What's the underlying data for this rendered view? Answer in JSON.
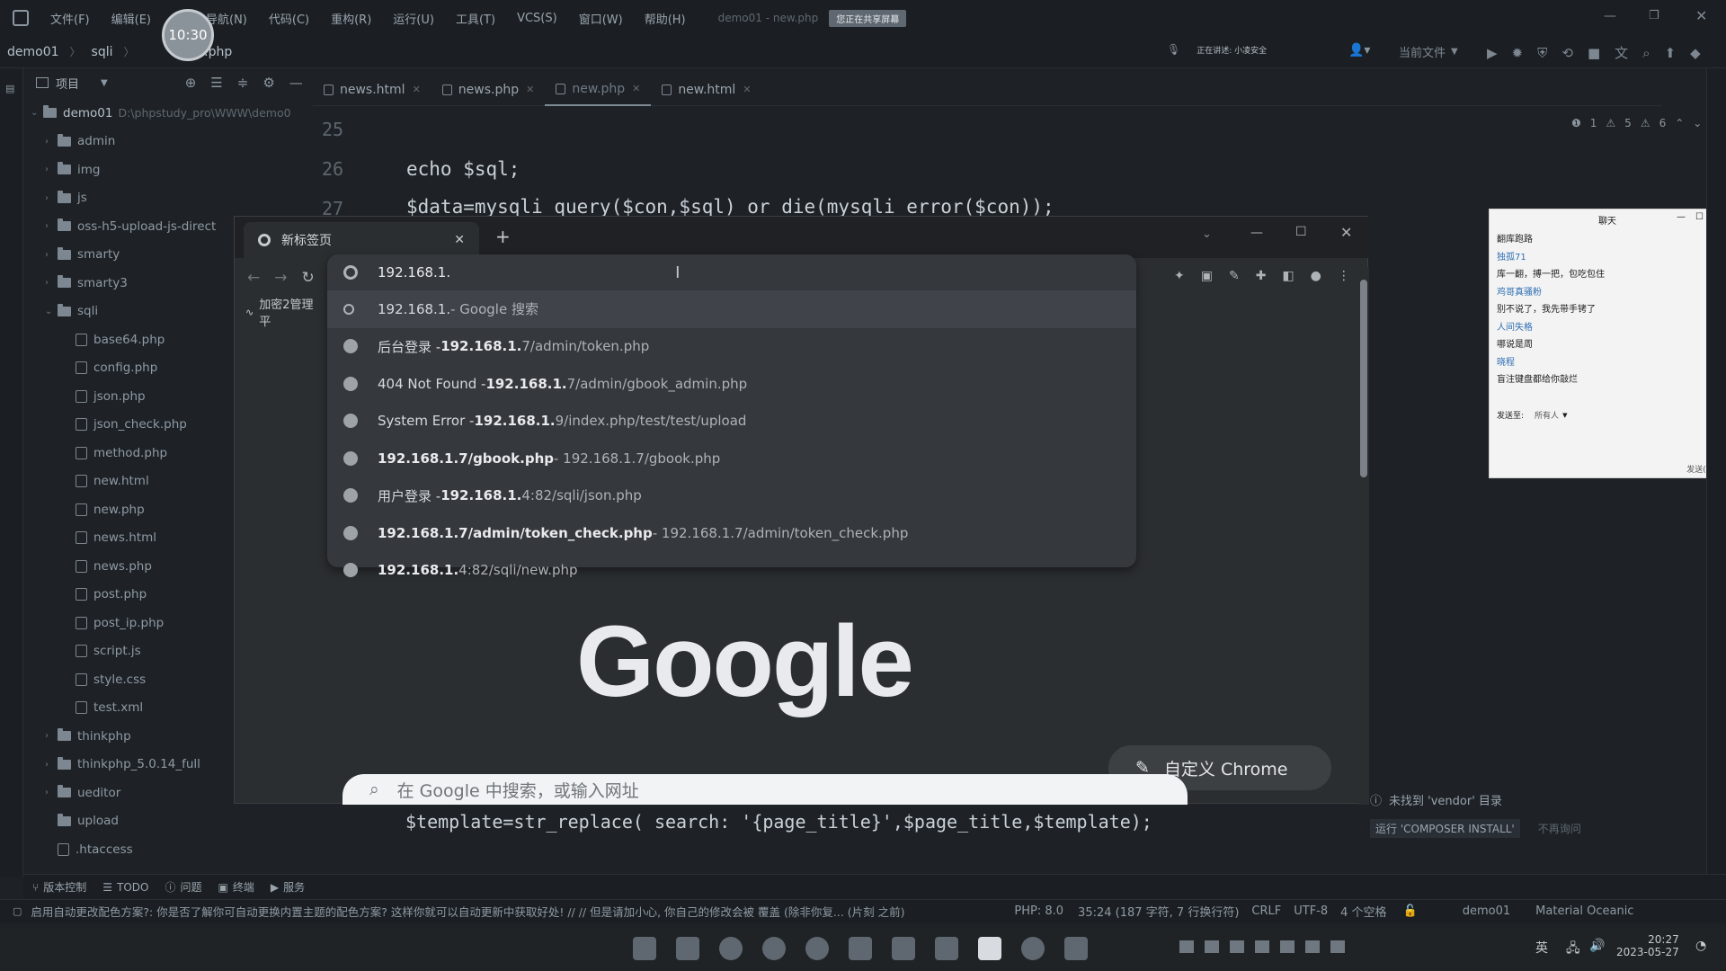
{
  "ide": {
    "menu": [
      "文件(F)",
      "编辑(E)",
      "视",
      "导航(N)",
      "代码(C)",
      "重构(R)",
      "运行(U)",
      "工具(T)",
      "VCS(S)",
      "窗口(W)",
      "帮助(H)"
    ],
    "title_hint": "demo01 - new.php",
    "sharing_badge": "您正在共享屏幕",
    "breadcrumb": [
      "demo01",
      "sqli",
      "new.php"
    ],
    "recording_time": "10:30",
    "speaking": "正在讲述: 小凌安全",
    "run_config": "当前文件",
    "project_label": "项目",
    "inspections": {
      "warn1": "1",
      "warn2": "5",
      "warn3": "6"
    }
  },
  "tree": [
    {
      "label": "demo01",
      "path": "D:\\phpstudy_pro\\WWW\\demo0",
      "depth": 0,
      "type": "folder",
      "open": true
    },
    {
      "label": "admin",
      "depth": 1,
      "type": "folder"
    },
    {
      "label": "img",
      "depth": 1,
      "type": "folder"
    },
    {
      "label": "js",
      "depth": 1,
      "type": "folder"
    },
    {
      "label": "oss-h5-upload-js-direct",
      "depth": 1,
      "type": "folder"
    },
    {
      "label": "smarty",
      "depth": 1,
      "type": "folder"
    },
    {
      "label": "smarty3",
      "depth": 1,
      "type": "folder"
    },
    {
      "label": "sqli",
      "depth": 1,
      "type": "folder",
      "open": true
    },
    {
      "label": "base64.php",
      "depth": 2,
      "type": "file"
    },
    {
      "label": "config.php",
      "depth": 2,
      "type": "file"
    },
    {
      "label": "json.php",
      "depth": 2,
      "type": "file"
    },
    {
      "label": "json_check.php",
      "depth": 2,
      "type": "file"
    },
    {
      "label": "method.php",
      "depth": 2,
      "type": "file"
    },
    {
      "label": "new.html",
      "depth": 2,
      "type": "file"
    },
    {
      "label": "new.php",
      "depth": 2,
      "type": "file"
    },
    {
      "label": "news.html",
      "depth": 2,
      "type": "file"
    },
    {
      "label": "news.php",
      "depth": 2,
      "type": "file"
    },
    {
      "label": "post.php",
      "depth": 2,
      "type": "file"
    },
    {
      "label": "post_ip.php",
      "depth": 2,
      "type": "file"
    },
    {
      "label": "script.js",
      "depth": 2,
      "type": "file"
    },
    {
      "label": "style.css",
      "depth": 2,
      "type": "file"
    },
    {
      "label": "test.xml",
      "depth": 2,
      "type": "file"
    },
    {
      "label": "thinkphp",
      "depth": 1,
      "type": "folder"
    },
    {
      "label": "thinkphp_5.0.14_full",
      "depth": 1,
      "type": "folder"
    },
    {
      "label": "ueditor",
      "depth": 1,
      "type": "folder"
    },
    {
      "label": "upload",
      "depth": 1,
      "type": "folder",
      "nochev": true
    },
    {
      "label": ".htaccess",
      "depth": 1,
      "type": "file"
    }
  ],
  "editor": {
    "tabs": [
      "news.html",
      "news.php",
      "new.php",
      "new.html"
    ],
    "active_tab": 2,
    "lines": [
      {
        "num": "25",
        "code": ""
      },
      {
        "num": "26",
        "code": "echo $sql;"
      },
      {
        "num": "27",
        "code": "$data=mysqli_query($con,$sql) or die(mysqli_error($con));"
      }
    ],
    "bottom_line": "$template=str_replace( search: '{page_title}',$page_title,$template);"
  },
  "browser": {
    "tab_title": "新标签页",
    "address": "192.168.1.",
    "bookmark": "加密2管理平",
    "suggestions": [
      {
        "title": "192.168.1.",
        "url": " - Google 搜索",
        "kind": "search"
      },
      {
        "title": "后台登录 - ",
        "bold": "192.168.1.",
        "url": "7/admin/token.php"
      },
      {
        "title": "404 Not Found - ",
        "bold": "192.168.1.",
        "url": "7/admin/gbook_admin.php"
      },
      {
        "title": "System Error - ",
        "bold": "192.168.1.",
        "url": "9/index.php/test/test/upload"
      },
      {
        "title": "",
        "bold": "192.168.1.7/gbook.php",
        "url": " - 192.168.1.7/gbook.php"
      },
      {
        "title": "用户登录 - ",
        "bold": "192.168.1.",
        "url": "4:82/sqli/json.php"
      },
      {
        "title": "",
        "bold": "192.168.1.7/admin/token_check.php",
        "url": " - 192.168.1.7/admin/token_check.php"
      },
      {
        "title": "",
        "bold": "192.168.1.",
        "url": "4:82/sqli/new.php"
      }
    ],
    "google_logo": "Google",
    "customize": "自定义 Chrome",
    "search_placeholder": "在 Google 中搜索，或输入网址"
  },
  "chat": {
    "title": "聊天",
    "lines": [
      {
        "text": "翻库跑路",
        "sys": false
      },
      {
        "text": "独孤71",
        "sys": true
      },
      {
        "text": "库一翻，搏一把，包吃包住",
        "sys": false
      },
      {
        "text": "鸡哥真骚粉",
        "sys": true
      },
      {
        "text": "别不说了，我先带手铐了",
        "sys": false
      },
      {
        "text": "人间失格",
        "sys": true
      },
      {
        "text": "哪说是周",
        "sys": false
      },
      {
        "text": "晓程",
        "sys": true
      },
      {
        "text": "盲注键盘都给你敲烂",
        "sys": false
      }
    ],
    "send_to_label": "发送至:",
    "send_to_value": "所有人",
    "send_button": "发送(S)"
  },
  "notice": {
    "vendor": "未找到 'vendor' 目录",
    "composer": "运行 'COMPOSER INSTALL'",
    "dismiss": "不再询问"
  },
  "toolwindows": [
    "版本控制",
    "TODO",
    "问题",
    "终端",
    "服务"
  ],
  "status": {
    "message": "启用自动更改配色方案?: 你是否了解你可自动更换内置主题的配色方案? 这样你就可以自动更新中获取好处! // // 但是请加小心, 你自己的修改会被 覆盖 (除非你复... (片刻 之前)",
    "php": "PHP: 8.0",
    "position": "35:24 (187 字符, 7 行换行符)",
    "line_sep": "CRLF",
    "encoding": "UTF-8",
    "indent": "4 个空格",
    "project": "demo01",
    "theme": "Material Oceanic"
  },
  "taskbar": {
    "time": "20:27",
    "date": "2023-05-27",
    "lang": "英"
  }
}
